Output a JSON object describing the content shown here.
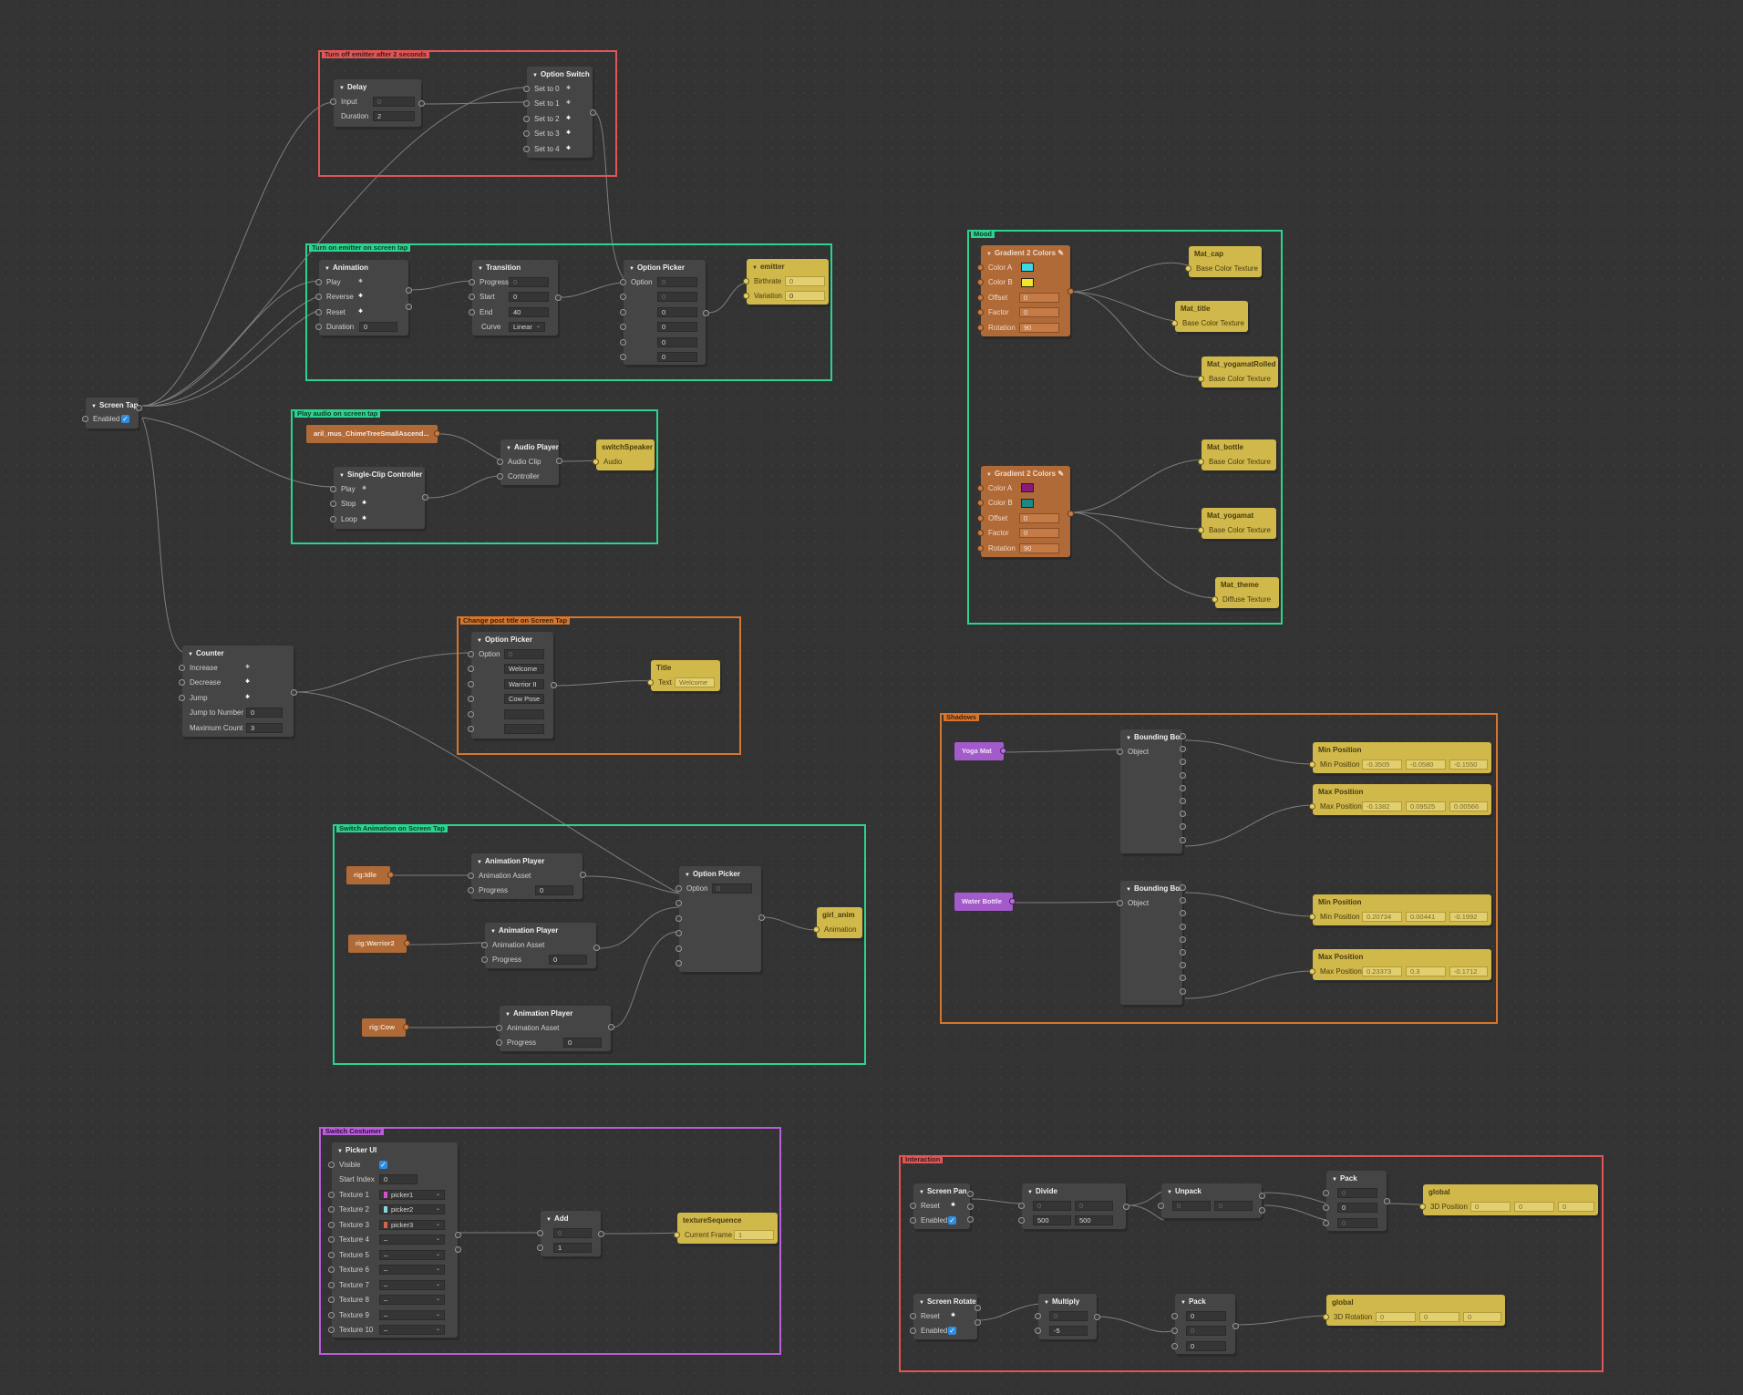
{
  "groups": {
    "turn_off": "Turn off emitter after 2 seconds",
    "turn_on": "Turn on emitter on screen tap",
    "play_audio": "Play audio on screen tap",
    "change_post": "Change post title on Screen Tap",
    "switch_anim": "Switch Animation on Screen Tap",
    "switch_costumer": "Switch Costumer",
    "mood": "Mood",
    "shadows": "Shadows",
    "interaction": "Interaction"
  },
  "colors": {
    "red_group": "#e05555",
    "green_group": "#2ad48e",
    "orange_group": "#d8752c",
    "purple_group": "#b85ed9",
    "yellow_node": "#d1b84b",
    "orange_node": "#b06a37",
    "purple_object": "#a35bc9"
  },
  "screen_tap": {
    "title": "Screen Tap",
    "enabled_label": "Enabled",
    "enabled": true
  },
  "delay": {
    "title": "Delay",
    "input_label": "Input",
    "input_value": "0",
    "duration_label": "Duration",
    "duration_value": "2"
  },
  "option_switch": {
    "title": "Option Switch",
    "items": [
      "Set to 0",
      "Set to 1",
      "Set to 2",
      "Set to 3",
      "Set to 4"
    ]
  },
  "animation": {
    "title": "Animation",
    "play": "Play",
    "reverse": "Reverse",
    "reset": "Reset",
    "duration_label": "Duration",
    "duration_value": "0"
  },
  "transition": {
    "title": "Transition",
    "progress_label": "Progress",
    "progress_value": "0",
    "start_label": "Start",
    "start_value": "0",
    "end_label": "End",
    "end_value": "40",
    "curve_label": "Curve",
    "curve_value": "Linear"
  },
  "option_picker_1": {
    "title": "Option Picker",
    "option_label": "Option",
    "values": [
      "0",
      "0",
      "0",
      "0",
      "0",
      "0"
    ]
  },
  "emitter": {
    "title": "emitter",
    "birthrate_label": "Birthrate",
    "birthrate_value": "0",
    "variation_label": "Variation",
    "variation_value": "0"
  },
  "audio_asset": {
    "label": "aril_mus_ChimeTreeSmallAscend..."
  },
  "audio_player": {
    "title": "Audio Player",
    "clip_label": "Audio Clip",
    "controller_label": "Controller"
  },
  "switch_speaker": {
    "title": "switchSpeaker",
    "audio_label": "Audio"
  },
  "single_clip": {
    "title": "Single-Clip Controller",
    "play": "Play",
    "stop": "Stop",
    "loop": "Loop"
  },
  "counter": {
    "title": "Counter",
    "increase": "Increase",
    "decrease": "Decrease",
    "jump": "Jump",
    "jump_to_label": "Jump to Number",
    "jump_to_value": "0",
    "max_label": "Maximum Count",
    "max_value": "3"
  },
  "option_picker_2": {
    "title": "Option Picker",
    "option_label": "Option",
    "option_value": "0",
    "values": [
      "Welcome",
      "Warrior II",
      "Cow Pose",
      "",
      ""
    ]
  },
  "title_node": {
    "title": "Title",
    "text_label": "Text",
    "text_value": "Welcome"
  },
  "rig_idle": {
    "label": "rig:Idle"
  },
  "rig_warrior": {
    "label": "rig:Warrior2"
  },
  "rig_cow": {
    "label": "rig:Cow"
  },
  "anim_player_1": {
    "title": "Animation Player",
    "asset_label": "Animation Asset",
    "progress_label": "Progress",
    "progress_value": "0"
  },
  "anim_player_2": {
    "title": "Animation Player",
    "asset_label": "Animation Asset",
    "progress_label": "Progress",
    "progress_value": "0"
  },
  "anim_player_3": {
    "title": "Animation Player",
    "asset_label": "Animation Asset",
    "progress_label": "Progress",
    "progress_value": "0"
  },
  "option_picker_3": {
    "title": "Option Picker",
    "option_label": "Option",
    "option_value": "0"
  },
  "girl_anim": {
    "title": "girl_anim",
    "animation_label": "Animation"
  },
  "picker_ui": {
    "title": "Picker UI",
    "visible_label": "Visible",
    "start_index_label": "Start Index",
    "start_index_value": "0",
    "textures": [
      {
        "label": "Texture 1",
        "value": "picker1",
        "color": "#d94fd0"
      },
      {
        "label": "Texture 2",
        "value": "picker2",
        "color": "#8fd1d9"
      },
      {
        "label": "Texture 3",
        "value": "picker3",
        "color": "#d9604f"
      },
      {
        "label": "Texture 4",
        "value": "–",
        "color": ""
      },
      {
        "label": "Texture 5",
        "value": "–",
        "color": ""
      },
      {
        "label": "Texture 6",
        "value": "–",
        "color": ""
      },
      {
        "label": "Texture 7",
        "value": "–",
        "color": ""
      },
      {
        "label": "Texture 8",
        "value": "–",
        "color": ""
      },
      {
        "label": "Texture 9",
        "value": "–",
        "color": ""
      },
      {
        "label": "Texture 10",
        "value": "–",
        "color": ""
      }
    ]
  },
  "add": {
    "title": "Add",
    "value1": "0",
    "value2": "1"
  },
  "texture_sequence": {
    "title": "textureSequence",
    "frame_label": "Current Frame",
    "frame_value": "1"
  },
  "gradient_1": {
    "title": "Gradient 2 Colors",
    "color_a_label": "Color A",
    "color_a": "#3fd6e8",
    "color_b_label": "Color B",
    "color_b": "#f2e626",
    "offset_label": "Offset",
    "offset_value": "0",
    "factor_label": "Factor",
    "factor_value": "0",
    "rotation_label": "Rotation",
    "rotation_value": "90"
  },
  "gradient_2": {
    "title": "Gradient 2 Colors",
    "color_a_label": "Color A",
    "color_a": "#8a1a7a",
    "color_b_label": "Color B",
    "color_b": "#1a8a86",
    "offset_label": "Offset",
    "offset_value": "0",
    "factor_label": "Factor",
    "factor_value": "0",
    "rotation_label": "Rotation",
    "rotation_value": "90"
  },
  "materials": [
    {
      "title": "Mat_cap",
      "label": "Base Color Texture"
    },
    {
      "title": "Mat_title",
      "label": "Base Color Texture"
    },
    {
      "title": "Mat_yogamatRolled",
      "label": "Base Color Texture"
    },
    {
      "title": "Mat_bottle",
      "label": "Base Color Texture"
    },
    {
      "title": "Mat_yogamat",
      "label": "Base Color Texture"
    },
    {
      "title": "Mat_theme",
      "label": "Diffuse Texture"
    }
  ],
  "yoga_mat": {
    "label": "Yoga Mat"
  },
  "water_bottle": {
    "label": "Water Bottle"
  },
  "bbox_1": {
    "title": "Bounding Box",
    "object_label": "Object"
  },
  "bbox_2": {
    "title": "Bounding Box",
    "object_label": "Object"
  },
  "min_pos_1": {
    "title": "Min Position",
    "label": "Min Position",
    "values": [
      "-0.3505",
      "-0.0580",
      "-0.1550"
    ]
  },
  "max_pos_1": {
    "title": "Max Position",
    "label": "Max Position",
    "values": [
      "-0.1382",
      "0.09525",
      "0.00566"
    ]
  },
  "min_pos_2": {
    "title": "Min Position",
    "label": "Min Position",
    "values": [
      "0.20734",
      "0.00441",
      "-0.1992"
    ]
  },
  "max_pos_2": {
    "title": "Max Position",
    "label": "Max Position",
    "values": [
      "0.23373",
      "0.3",
      "-0.1712"
    ]
  },
  "screen_pan": {
    "title": "Screen Pan",
    "reset_label": "Reset",
    "enabled_label": "Enabled"
  },
  "divide": {
    "title": "Divide",
    "values": [
      "0",
      "0",
      "500",
      "500"
    ]
  },
  "unpack": {
    "title": "Unpack",
    "values": [
      "0",
      "0"
    ]
  },
  "pack_1": {
    "title": "Pack",
    "values": [
      "0",
      "0",
      "0"
    ]
  },
  "global_1": {
    "title": "global",
    "label": "3D Position",
    "values": [
      "0",
      "0",
      "0"
    ]
  },
  "screen_rotate": {
    "title": "Screen Rotate",
    "reset_label": "Reset",
    "enabled_label": "Enabled"
  },
  "multiply": {
    "title": "Multiply",
    "values": [
      "0",
      "-5"
    ]
  },
  "pack_2": {
    "title": "Pack",
    "values": [
      "0",
      "0",
      "0"
    ]
  },
  "global_2": {
    "title": "global",
    "label": "3D Rotation",
    "values": [
      "0",
      "0",
      "0"
    ]
  }
}
